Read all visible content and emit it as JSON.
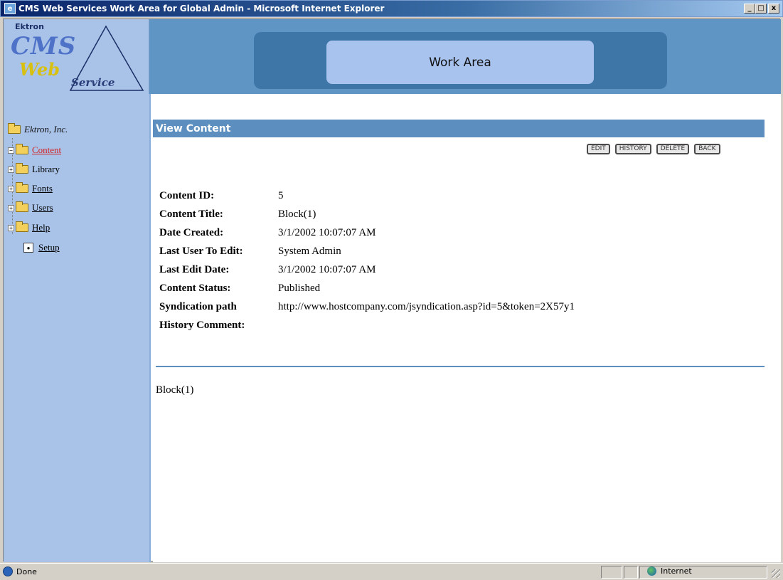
{
  "window": {
    "title": "CMS Web Services Work Area for Global Admin - Microsoft Internet Explorer",
    "min": "_",
    "max": "□",
    "close": "x"
  },
  "logo": {
    "company": "Ektron",
    "cms": "CMS",
    "web": "Web",
    "service": "Service"
  },
  "header": {
    "work_area": "Work Area"
  },
  "sidebar": {
    "root": "Ektron, Inc.",
    "items": [
      {
        "label": "Content",
        "expander": "−"
      },
      {
        "label": "Library",
        "expander": "+"
      },
      {
        "label": "Fonts",
        "expander": "+"
      },
      {
        "label": "Users",
        "expander": "+"
      },
      {
        "label": "Help",
        "expander": "+"
      },
      {
        "label": "Setup"
      }
    ]
  },
  "main": {
    "section_title": "View Content",
    "buttons": {
      "edit": "EDIT",
      "history": "HISTORY",
      "delete": "DELETE",
      "back": "BACK"
    },
    "fields": [
      {
        "label": "Content ID:",
        "value": "5"
      },
      {
        "label": "Content Title:",
        "value": "Block(1)"
      },
      {
        "label": "Date Created:",
        "value": "3/1/2002 10:07:07 AM"
      },
      {
        "label": "Last User To Edit:",
        "value": "System Admin"
      },
      {
        "label": "Last Edit Date:",
        "value": "3/1/2002 10:07:07 AM"
      },
      {
        "label": "Content Status:",
        "value": "Published"
      },
      {
        "label": "Syndication path",
        "value": "http://www.hostcompany.com/jsyndication.asp?id=5&token=2X57y1"
      },
      {
        "label": "History Comment:",
        "value": ""
      }
    ],
    "body": "Block(1)"
  },
  "status": {
    "text": "Done",
    "zone": "Internet"
  }
}
